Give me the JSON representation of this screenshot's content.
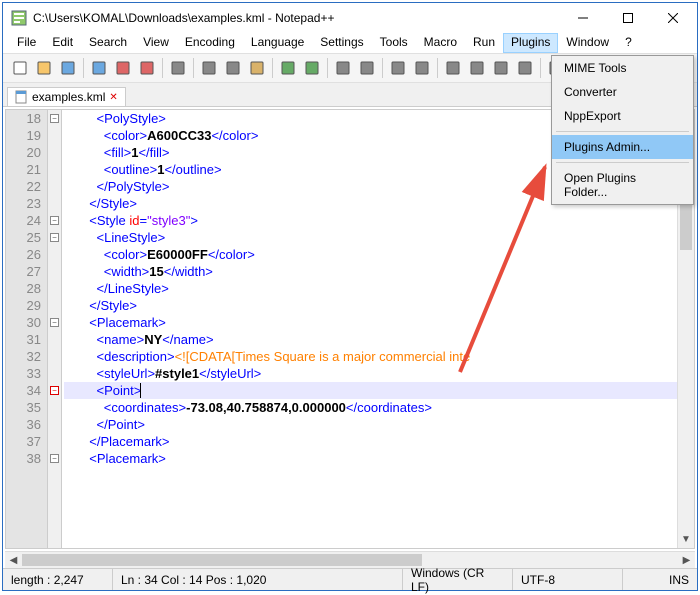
{
  "window": {
    "title": "C:\\Users\\KOMAL\\Downloads\\examples.kml - Notepad++"
  },
  "menubar": [
    "File",
    "Edit",
    "Search",
    "View",
    "Encoding",
    "Language",
    "Settings",
    "Tools",
    "Macro",
    "Run",
    "Plugins",
    "Window",
    "?"
  ],
  "tab": {
    "label": "examples.kml"
  },
  "dropdown": {
    "items": [
      "MIME Tools",
      "Converter",
      "NppExport",
      "Plugins Admin...",
      "Open Plugins Folder..."
    ],
    "highlighted": 3
  },
  "code_lines": [
    {
      "n": 18,
      "indent": 9,
      "tokens": [
        {
          "t": "tag",
          "v": "<PolyStyle>"
        }
      ]
    },
    {
      "n": 19,
      "indent": 11,
      "tokens": [
        {
          "t": "tag",
          "v": "<color>"
        },
        {
          "t": "txt",
          "v": "A600CC33"
        },
        {
          "t": "tag",
          "v": "</color>"
        }
      ]
    },
    {
      "n": 20,
      "indent": 11,
      "tokens": [
        {
          "t": "tag",
          "v": "<fill>"
        },
        {
          "t": "txt",
          "v": "1"
        },
        {
          "t": "tag",
          "v": "</fill>"
        }
      ]
    },
    {
      "n": 21,
      "indent": 11,
      "tokens": [
        {
          "t": "tag",
          "v": "<outline>"
        },
        {
          "t": "txt",
          "v": "1"
        },
        {
          "t": "tag",
          "v": "</outline>"
        }
      ]
    },
    {
      "n": 22,
      "indent": 9,
      "tokens": [
        {
          "t": "tag",
          "v": "</PolyStyle>"
        }
      ]
    },
    {
      "n": 23,
      "indent": 7,
      "tokens": [
        {
          "t": "tag",
          "v": "</Style>"
        }
      ]
    },
    {
      "n": 24,
      "indent": 7,
      "tokens": [
        {
          "t": "tag",
          "v": "<Style "
        },
        {
          "t": "attr",
          "v": "id"
        },
        {
          "t": "tag",
          "v": "="
        },
        {
          "t": "val",
          "v": "\"style3\""
        },
        {
          "t": "tag",
          "v": ">"
        }
      ]
    },
    {
      "n": 25,
      "indent": 9,
      "tokens": [
        {
          "t": "tag",
          "v": "<LineStyle>"
        }
      ]
    },
    {
      "n": 26,
      "indent": 11,
      "tokens": [
        {
          "t": "tag",
          "v": "<color>"
        },
        {
          "t": "txt",
          "v": "E60000FF"
        },
        {
          "t": "tag",
          "v": "</color>"
        }
      ]
    },
    {
      "n": 27,
      "indent": 11,
      "tokens": [
        {
          "t": "tag",
          "v": "<width>"
        },
        {
          "t": "txt",
          "v": "15"
        },
        {
          "t": "tag",
          "v": "</width>"
        }
      ]
    },
    {
      "n": 28,
      "indent": 9,
      "tokens": [
        {
          "t": "tag",
          "v": "</LineStyle>"
        }
      ]
    },
    {
      "n": 29,
      "indent": 7,
      "tokens": [
        {
          "t": "tag",
          "v": "</Style>"
        }
      ]
    },
    {
      "n": 30,
      "indent": 7,
      "tokens": [
        {
          "t": "tag",
          "v": "<Placemark>"
        }
      ]
    },
    {
      "n": 31,
      "indent": 9,
      "tokens": [
        {
          "t": "tag",
          "v": "<name>"
        },
        {
          "t": "txt",
          "v": "NY"
        },
        {
          "t": "tag",
          "v": "</name>"
        }
      ]
    },
    {
      "n": 32,
      "indent": 9,
      "tokens": [
        {
          "t": "tag",
          "v": "<description>"
        },
        {
          "t": "cdata",
          "v": "<![CDATA[Times Square is a major commercial inte"
        }
      ]
    },
    {
      "n": 33,
      "indent": 9,
      "tokens": [
        {
          "t": "tag",
          "v": "<styleUrl>"
        },
        {
          "t": "txt",
          "v": "#style1"
        },
        {
          "t": "tag",
          "v": "</styleUrl>"
        }
      ]
    },
    {
      "n": 34,
      "indent": 9,
      "hl": true,
      "tokens": [
        {
          "t": "tag",
          "v": "<Point>"
        }
      ],
      "cursor": true
    },
    {
      "n": 35,
      "indent": 11,
      "tokens": [
        {
          "t": "tag",
          "v": "<coordinates>"
        },
        {
          "t": "txt",
          "v": "-73.08,40.758874,0.000000"
        },
        {
          "t": "tag",
          "v": "</coordinates>"
        }
      ]
    },
    {
      "n": 36,
      "indent": 9,
      "tokens": [
        {
          "t": "tag",
          "v": "</Point>"
        }
      ]
    },
    {
      "n": 37,
      "indent": 7,
      "tokens": [
        {
          "t": "tag",
          "v": "</Placemark>"
        }
      ]
    },
    {
      "n": 38,
      "indent": 7,
      "tokens": [
        {
          "t": "tag",
          "v": "<Placemark>"
        }
      ]
    }
  ],
  "fold_marks": [
    {
      "line": 0,
      "type": "minus"
    },
    {
      "line": 6,
      "type": "minus"
    },
    {
      "line": 7,
      "type": "minus"
    },
    {
      "line": 12,
      "type": "minus"
    },
    {
      "line": 16,
      "type": "minus",
      "color": "red"
    },
    {
      "line": 20,
      "type": "minus"
    }
  ],
  "statusbar": {
    "length": "length : 2,247",
    "pos": "Ln : 34   Col : 14   Pos : 1,020",
    "eol": "Windows (CR LF)",
    "enc": "UTF-8",
    "ins": "INS"
  },
  "toolbar_icons": [
    "new",
    "open",
    "save",
    "save-all",
    "close",
    "close-all",
    "print",
    "cut",
    "copy",
    "paste",
    "undo",
    "redo",
    "find",
    "replace",
    "zoom-in",
    "zoom-out",
    "sync",
    "wrap",
    "show-all",
    "indent",
    "lang",
    "macro-rec",
    "macro-play",
    "macro-run"
  ]
}
